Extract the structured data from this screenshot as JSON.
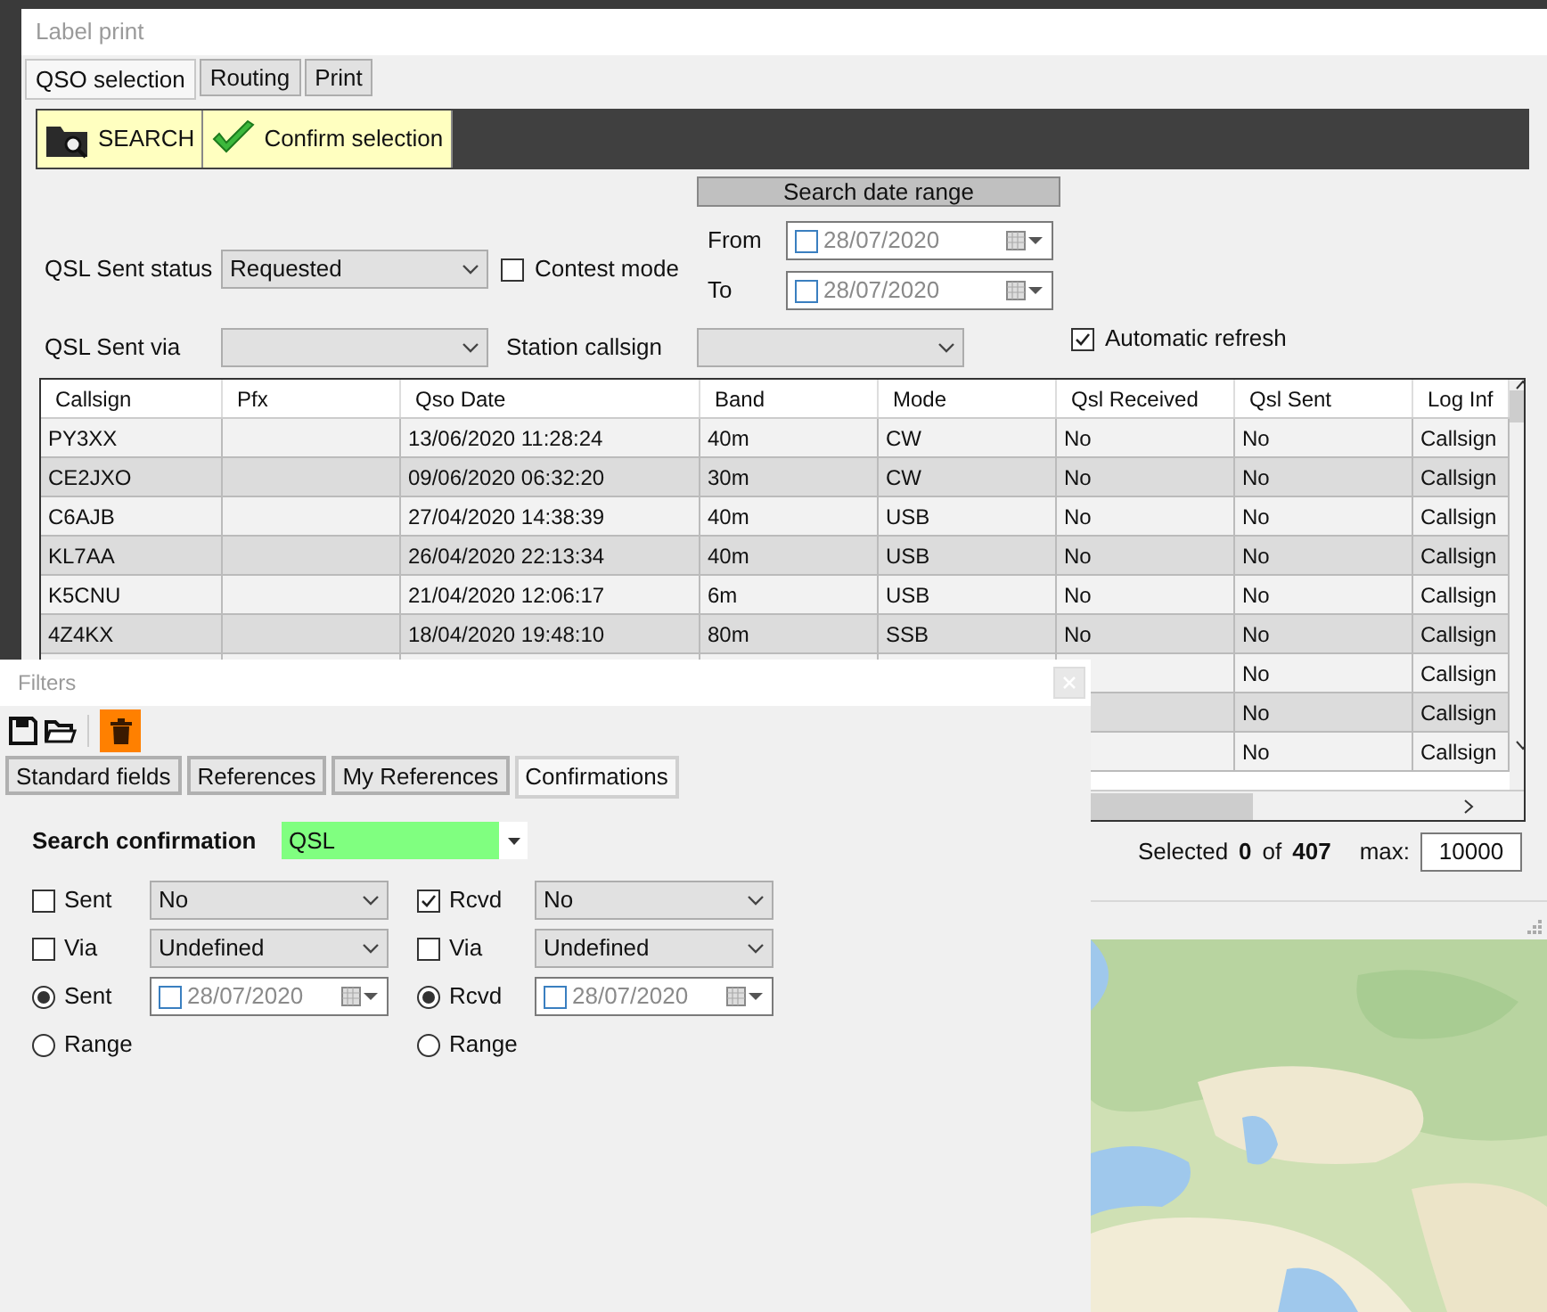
{
  "label_print": {
    "title": "Label print",
    "tabs": [
      {
        "label": "QSO selection",
        "selected": true
      },
      {
        "label": "Routing",
        "selected": false
      },
      {
        "label": "Print",
        "selected": false
      }
    ],
    "toolbar": [
      {
        "kind": "search",
        "label": "SEARCH"
      },
      {
        "kind": "confirm",
        "label": "Confirm selection"
      }
    ],
    "qsl_sent_status": {
      "label": "QSL Sent status",
      "value": "Requested"
    },
    "contest_mode": {
      "label": "Contest mode",
      "checked": false
    },
    "date_range": {
      "title": "Search date range",
      "from": {
        "label": "From",
        "value": "28/07/2020",
        "checked": false
      },
      "to": {
        "label": "To",
        "value": "28/07/2020",
        "checked": false
      }
    },
    "qsl_sent_via": {
      "label": "QSL Sent via"
    },
    "station_callsign": {
      "label": "Station callsign"
    },
    "automatic_refresh": {
      "label": "Automatic refresh",
      "checked": true
    },
    "table": {
      "columns": [
        "Callsign",
        "Pfx",
        "Qso Date",
        "Band",
        "Mode",
        "Qsl Received",
        "Qsl Sent",
        "Log Inf"
      ],
      "rows": [
        {
          "cells": [
            "PY3XX",
            null,
            "13/06/2020 11:28:24",
            "40m",
            "CW",
            "No",
            "No",
            "Callsign"
          ]
        },
        {
          "cells": [
            "CE2JXO",
            null,
            "09/06/2020 06:32:20",
            "30m",
            "CW",
            "No",
            "No",
            "Callsign"
          ]
        },
        {
          "cells": [
            "C6AJB",
            null,
            "27/04/2020 14:38:39",
            "40m",
            "USB",
            "No",
            "No",
            "Callsign"
          ]
        },
        {
          "cells": [
            "KL7AA",
            null,
            "26/04/2020 22:13:34",
            "40m",
            "USB",
            "No",
            "No",
            "Callsign"
          ]
        },
        {
          "cells": [
            "K5CNU",
            null,
            "21/04/2020 12:06:17",
            "6m",
            "USB",
            "No",
            "No",
            "Callsign"
          ]
        },
        {
          "cells": [
            "4Z4KX",
            null,
            "18/04/2020 19:48:10",
            "80m",
            "SSB",
            "No",
            "No",
            "Callsign"
          ]
        },
        {
          "cells": [
            null,
            null,
            null,
            null,
            null,
            null,
            "No",
            "Callsign"
          ]
        },
        {
          "cells": [
            null,
            null,
            null,
            null,
            null,
            null,
            "No",
            "Callsign"
          ]
        },
        {
          "cells": [
            null,
            null,
            null,
            null,
            null,
            null,
            "No",
            "Callsign"
          ]
        }
      ]
    },
    "status": {
      "selected_label": "Selected",
      "selected": "0",
      "of_label": "of",
      "total": "407",
      "max_label": "max:",
      "max": "10000"
    }
  },
  "filters": {
    "title": "Filters",
    "tabs": [
      {
        "label": "Standard fields",
        "selected": false
      },
      {
        "label": "References",
        "selected": false
      },
      {
        "label": "My References",
        "selected": false
      },
      {
        "label": "Confirmations",
        "selected": true
      }
    ],
    "search_confirmation": {
      "label": "Search confirmation",
      "value": "QSL"
    },
    "columns": [
      [
        {
          "kind": "checkbox",
          "label": "Sent",
          "checked": false,
          "value": "No"
        },
        {
          "kind": "checkbox",
          "label": "Via",
          "checked": false,
          "value": "Undefined"
        },
        {
          "kind": "radio",
          "label": "Sent",
          "selected": true,
          "date": "28/07/2020",
          "date_checked": false
        },
        {
          "kind": "radio",
          "label": "Range",
          "selected": false
        }
      ],
      [
        {
          "kind": "checkbox",
          "label": "Rcvd",
          "checked": true,
          "value": "No"
        },
        {
          "kind": "checkbox",
          "label": "Via",
          "checked": false,
          "value": "Undefined"
        },
        {
          "kind": "radio",
          "label": "Rcvd",
          "selected": true,
          "date": "28/07/2020",
          "date_checked": false
        },
        {
          "kind": "radio",
          "label": "Range",
          "selected": false
        }
      ]
    ]
  }
}
